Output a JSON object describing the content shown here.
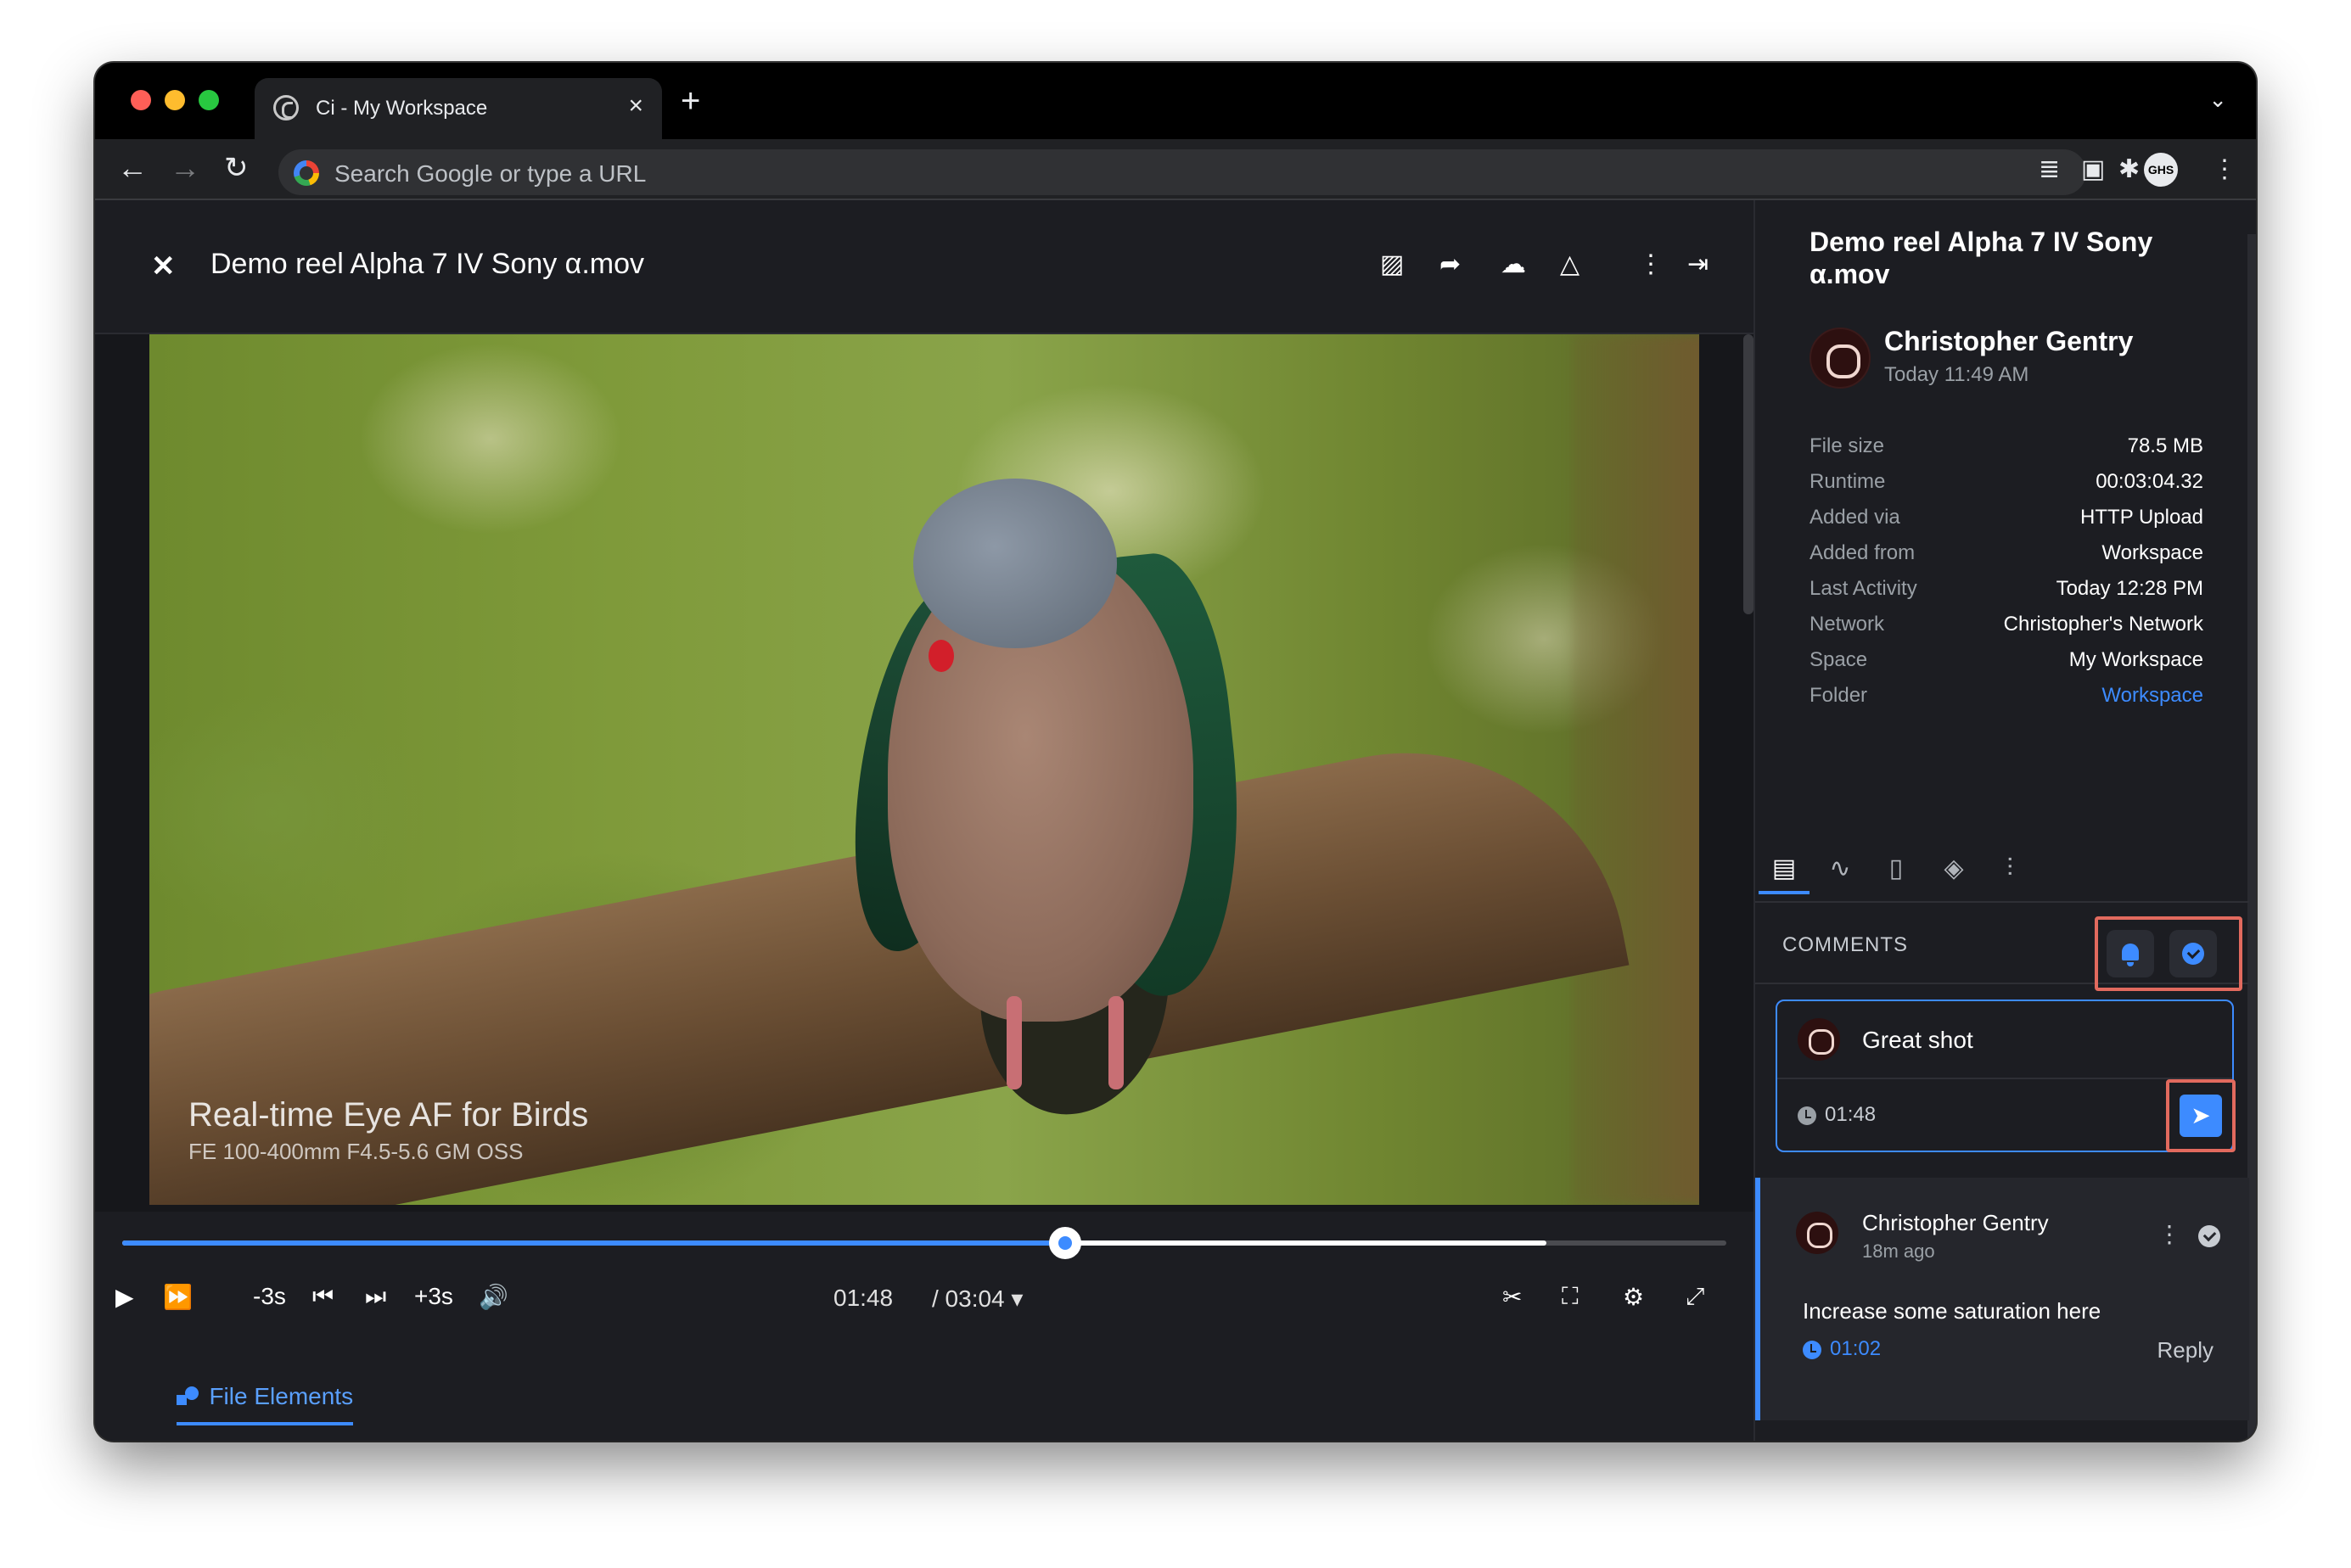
{
  "browser": {
    "tab_title": "Ci - My Workspace",
    "tab_close_icon": "×",
    "new_tab_icon": "+",
    "tab_menu_icon": "⌄",
    "omnibox_placeholder": "Search Google or type a URL",
    "icons": {
      "back": "←",
      "forward": "→",
      "reload": "↻",
      "extensions": "✱",
      "media": "≣",
      "sidepanel": "▣",
      "menu": "⋮"
    },
    "profile_initials": "GHS"
  },
  "viewer": {
    "close_icon": "✕",
    "file_title": "Demo reel Alpha 7 IV Sony α.mov",
    "header_icons": {
      "image": "▨",
      "share": "➦",
      "cloud_download": "☁",
      "drive": "△",
      "more": "⋮",
      "exit": "⇥"
    },
    "video_overlay_title": "Real-time Eye AF for Birds",
    "video_overlay_subtitle": "FE 100-400mm F4.5-5.6 GM OSS",
    "player": {
      "played_fraction": 0.588,
      "buffered_fraction": 0.888,
      "play_icon": "▶",
      "fast_forward_icon": "⏩",
      "rewind_label": "-3s",
      "prev_frame_icon": "⏮",
      "next_frame_icon": "⏭",
      "forward_label": "+3s",
      "volume_icon": "🔊",
      "current_time": "01:48",
      "duration": "/ 03:04",
      "duration_caret": "▾",
      "scissors_icon": "✂",
      "aspect_icon": "⛶",
      "settings_icon": "⚙",
      "fullscreen_icon": "⤢"
    },
    "bottom_tab_label": "File Elements"
  },
  "panel": {
    "title": "Demo reel Alpha 7 IV Sony α.mov",
    "owner_name": "Christopher Gentry",
    "owner_time": "Today 11:49 AM",
    "metadata": [
      {
        "key": "File size",
        "value": "78.5 MB"
      },
      {
        "key": "Runtime",
        "value": "00:03:04.32"
      },
      {
        "key": "Added via",
        "value": "HTTP Upload"
      },
      {
        "key": "Added from",
        "value": "Workspace"
      },
      {
        "key": "Last Activity",
        "value": "Today 12:28 PM"
      },
      {
        "key": "Network",
        "value": "Christopher's Network"
      },
      {
        "key": "Space",
        "value": "My Workspace"
      },
      {
        "key": "Folder",
        "value": "Workspace"
      }
    ],
    "tab_icons": {
      "comments": "▤",
      "activity": "∿",
      "document": "▯",
      "tag": "◈",
      "filters": "⫶"
    },
    "comments_label": "COMMENTS",
    "composer": {
      "text": "Great shot",
      "time": "01:48",
      "send_icon": "➤"
    },
    "comment": {
      "author": "Christopher Gentry",
      "age": "18m ago",
      "more_icon": "⋮",
      "text": "Increase some saturation here",
      "time": "01:02",
      "reply_label": "Reply"
    }
  }
}
